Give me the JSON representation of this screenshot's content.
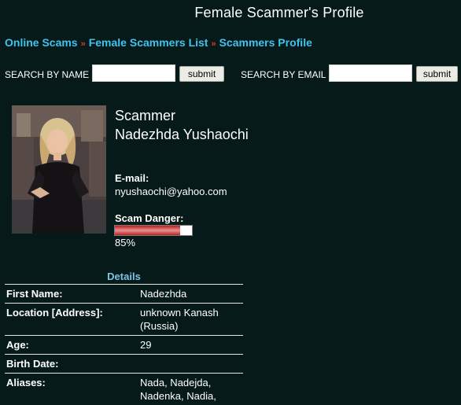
{
  "page": {
    "title": "Female Scammer's Profile"
  },
  "breadcrumb": {
    "items": [
      "Online Scams",
      "Female Scammers List",
      "Scammers Profile"
    ],
    "separator": "»"
  },
  "search": {
    "by_name_label": "SEARCH BY NAME :",
    "by_email_label": "SEARCH BY EMAIL :",
    "name_value": "",
    "email_value": "",
    "submit_label": "submit"
  },
  "profile": {
    "role": "Scammer",
    "name": "Nadezhda Yushaochi",
    "email_label": "E-mail:",
    "email": "nyushaochi@yahoo.com",
    "danger_label": "Scam Danger:",
    "danger_percent": 85,
    "danger_text": "85%"
  },
  "details": {
    "header": "Details",
    "rows": [
      {
        "key": "First Name:",
        "value": "Nadezhda"
      },
      {
        "key": "Location [Address]:",
        "value": "unknown Kanash (Russia)"
      },
      {
        "key": "Age:",
        "value": "29"
      },
      {
        "key": "Birth Date:",
        "value": ""
      },
      {
        "key": "Aliases:",
        "value": "Nada, Nadejda, Nadenka, Nadia,"
      }
    ]
  },
  "colors": {
    "background": "#061a1a",
    "link": "#41c3ee",
    "separator": "#d23d2a",
    "details_header": "#7ec4e6",
    "danger_fill": "#d44040"
  }
}
